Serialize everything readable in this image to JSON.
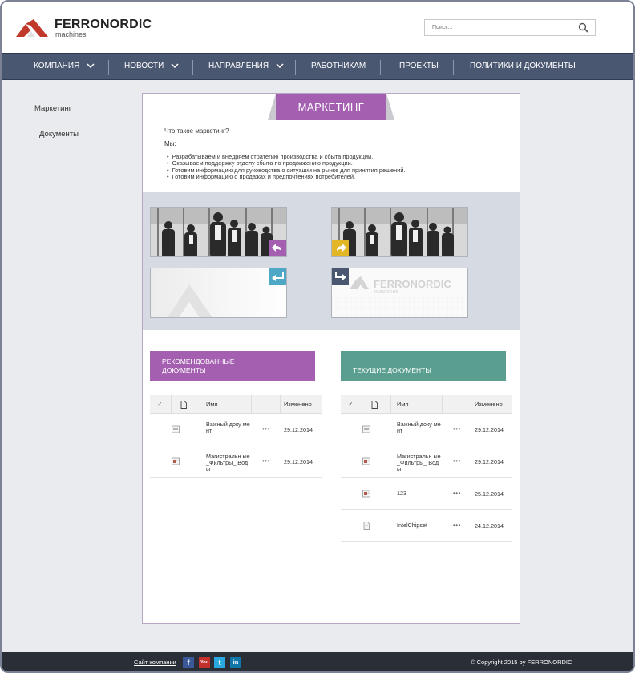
{
  "brand": {
    "name": "FERRONORDIC",
    "sub": "machines",
    "color": "#c0392b"
  },
  "search": {
    "placeholder": "Поиск..."
  },
  "nav": {
    "items": [
      {
        "label": "КОМПАНИЯ",
        "has_dropdown": true
      },
      {
        "label": "НОВОСТИ",
        "has_dropdown": true
      },
      {
        "label": "НАПРАВЛЕНИЯ",
        "has_dropdown": true
      },
      {
        "label": "РАБОТНИКАМ",
        "has_dropdown": false
      },
      {
        "label": "ПРОЕКТЫ",
        "has_dropdown": false
      },
      {
        "label": "ПОЛИТИКИ И ДОКУМЕНТЫ",
        "has_dropdown": false
      }
    ]
  },
  "sidebar": {
    "items": [
      {
        "label": "Маркетинг"
      },
      {
        "label": "Документы"
      }
    ]
  },
  "page": {
    "title": "МАРКЕТИНГ",
    "question": "Что такое маркетинг?",
    "we": "Мы:",
    "bullets": [
      "Разрабатываем и внедряем стратегию производства и сбыта продукции.",
      "Оказываем поддержку отделу сбыта по продвижению продукции.",
      "Готовим информацию для руководства о ситуации на рынке для принятия решений.",
      "Готовим информацию о продажах и предпочтениях потребителей."
    ],
    "tile_logo_name": "FERRONORDIC",
    "tile_logo_sub": "machines"
  },
  "recommended": {
    "title_line1": "РЕКОМЕНДОВАННЫЕ",
    "title_line2": "ДОКУМЕНТЫ",
    "columns": {
      "check": "✓",
      "name": "Имя",
      "modified": "Изменено"
    },
    "rows": [
      {
        "name": "Важный доку мент",
        "dots": "•••",
        "date": "29.12.2014",
        "icon": "document-icon"
      },
      {
        "name": "Магистральн ые_Фильтры_ Воды",
        "dots": "•••",
        "date": "29.12.2014",
        "icon": "presentation-icon"
      }
    ]
  },
  "current": {
    "title": "ТЕКУЩИЕ ДОКУМЕНТЫ",
    "columns": {
      "check": "✓",
      "name": "Имя",
      "modified": "Изменено"
    },
    "rows": [
      {
        "name": "Важный доку мент",
        "dots": "•••",
        "date": "29.12.2014",
        "icon": "document-icon"
      },
      {
        "name": "Магистральн ые_Фильтры_ Воды",
        "dots": "•••",
        "date": "29.12.2014",
        "icon": "presentation-icon"
      },
      {
        "name": "123",
        "dots": "•••",
        "date": "25.12.2014",
        "icon": "presentation-icon"
      },
      {
        "name": "IntelChipset",
        "dots": "•••",
        "date": "24.12.2014",
        "icon": "file-icon"
      }
    ]
  },
  "footer": {
    "site_link": "Сайт компании",
    "social": [
      {
        "label": "f",
        "icon": "facebook-icon",
        "color": "#3b5998"
      },
      {
        "label": "You",
        "icon": "youtube-icon",
        "color": "#c4302b"
      },
      {
        "label": "t",
        "icon": "twitter-icon",
        "color": "#2aa9e0"
      },
      {
        "label": "in",
        "icon": "linkedin-icon",
        "color": "#0e76a8"
      }
    ],
    "copyright": "© Copyright 2015 by FERRONORDIC"
  },
  "colors": {
    "purple": "#a45fb0",
    "green": "#5a9e8f",
    "nav": "#4a5771",
    "footer": "#2a2f37",
    "tile_purple": "#a45fb0",
    "tile_yellow": "#e3b626",
    "tile_teal": "#4ea7c4",
    "tile_slate": "#4a5771"
  }
}
